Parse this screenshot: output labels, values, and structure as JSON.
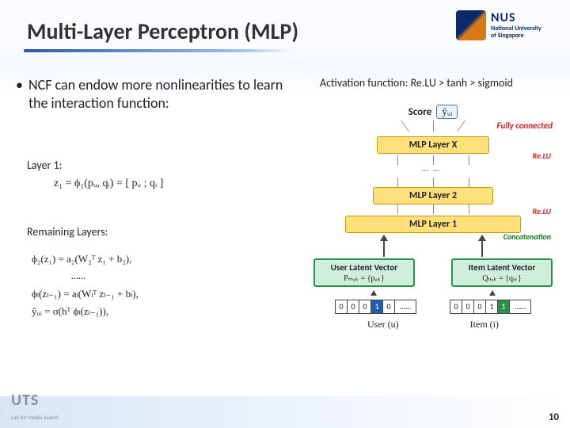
{
  "title": "Multi-Layer Perceptron (MLP)",
  "nus": {
    "abbr": "NUS",
    "name_line1": "National University",
    "name_line2": "of Singapore"
  },
  "bullet": "NCF can endow more nonlinearities to learn the interaction function:",
  "activation_note": "Activation function: Re.LU > tanh > sigmoid",
  "labels": {
    "layer1": "Layer 1:",
    "remaining": "Remaining Layers:"
  },
  "equations": {
    "layer1": "z₁ = ϕ₁(pᵤ, qᵢ) = [ pᵤ ; qᵢ ]",
    "phi2": "ϕ₂(z₁) = a₂(W₂ᵀ z₁ + b₂),",
    "ellipsis": "……",
    "phiL": "ϕₗ(zₗ₋₁) = aₗ(Wₗᵀ zₗ₋₁ + bₗ),",
    "yhat": "ŷᵤᵢ = σ(hᵀ ϕₗ(zₗ₋₁)),"
  },
  "diagram": {
    "score_label": "Score",
    "score_symbol": "ŷᵤᵢ",
    "fully_connected": "Fully connected",
    "layer_x": "MLP Layer X",
    "layer_2": "MLP Layer 2",
    "layer_1": "MLP Layer 1",
    "relu": "Re.LU",
    "concat": "Concatenation",
    "dots": "……",
    "user_latent": "User Latent Vector",
    "item_latent": "Item Latent Vector",
    "user_latent_sub": "Pₘₓₖ = {pᵤₖ}",
    "item_latent_sub": "Qₙₓₖ = {qᵢₖ}",
    "onehot_cells": [
      "0",
      "0",
      "0",
      "1",
      "0",
      "……"
    ],
    "user_label": "User (u)",
    "item_label": "Item (i)"
  },
  "footer": {
    "uts": "UTS",
    "uts_sub": "Lab for Media Search",
    "page": "10"
  }
}
